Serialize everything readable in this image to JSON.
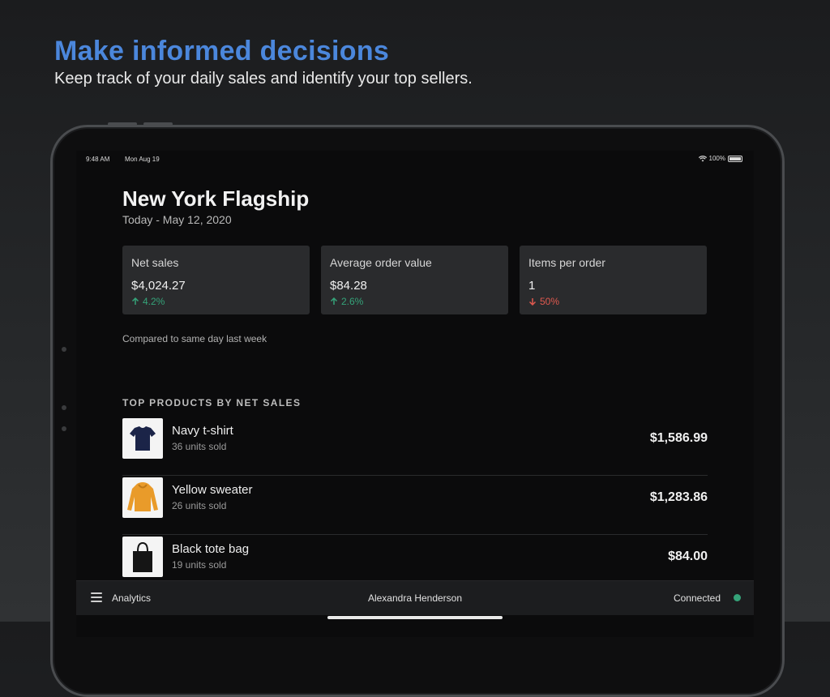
{
  "promo": {
    "title": "Make informed decisions",
    "subtitle": "Keep track of your daily sales and identify your top sellers."
  },
  "status_bar": {
    "time": "9:48 AM",
    "date": "Mon Aug 19",
    "battery": "100%",
    "icons": [
      "wifi-icon",
      "battery-icon"
    ]
  },
  "store": {
    "name": "New York Flagship",
    "date_range": "Today - May 12, 2020"
  },
  "metrics": [
    {
      "label": "Net sales",
      "value": "$4,024.27",
      "change": "4.2%",
      "direction": "up"
    },
    {
      "label": "Average order value",
      "value": "$84.28",
      "change": "2.6%",
      "direction": "up"
    },
    {
      "label": "Items per order",
      "value": "1",
      "change": "50%",
      "direction": "down"
    }
  ],
  "compare_note": "Compared to same day last week",
  "top_products": {
    "heading": "TOP PRODUCTS BY NET SALES",
    "items": [
      {
        "name": "Navy t-shirt",
        "units": "36 units sold",
        "amount": "$1,586.99",
        "icon": "navy-tshirt-image"
      },
      {
        "name": "Yellow sweater",
        "units": "26 units sold",
        "amount": "$1,283.86",
        "icon": "yellow-sweater-image"
      },
      {
        "name": "Black tote bag",
        "units": "19 units sold",
        "amount": "$84.00",
        "icon": "black-tote-bag-image"
      }
    ]
  },
  "bottom_bar": {
    "menu_label": "Analytics",
    "user": "Alexandra Henderson",
    "status": "Connected"
  },
  "colors": {
    "accent": "#4b87dc",
    "positive": "#35a379",
    "negative": "#e0594f",
    "card": "#2a2b2d",
    "screen": "#0b0b0c"
  }
}
